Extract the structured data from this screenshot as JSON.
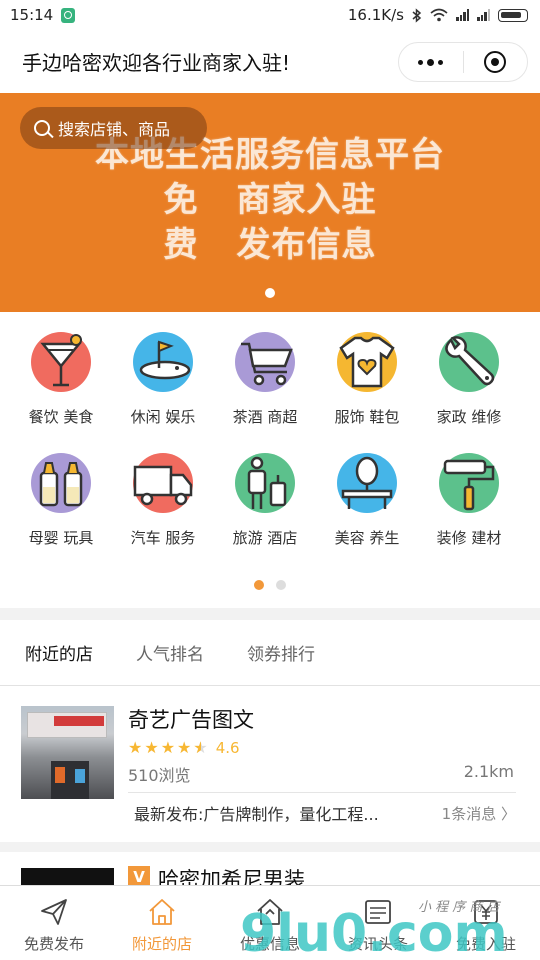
{
  "status_bar": {
    "time": "15:14",
    "network_speed": "16.1K/s"
  },
  "nav": {
    "title": "手边哈密欢迎各行业商家入驻!"
  },
  "banner": {
    "search_placeholder": "搜索店铺、商品",
    "line1": "本地生活服务信息平台",
    "line2_a": "免",
    "line2_b": "商家入驻",
    "line3_a": "费",
    "line3_b": "发布信息",
    "background_color": "#e97e24"
  },
  "categories": [
    {
      "label": "餐饮 美食",
      "icon": "cocktail-glass-icon",
      "color": "#f06b5f"
    },
    {
      "label": "休闲 娱乐",
      "icon": "golf-icon",
      "color": "#45b5e8"
    },
    {
      "label": "茶酒 商超",
      "icon": "shopping-cart-icon",
      "color": "#a99ad6"
    },
    {
      "label": "服饰 鞋包",
      "icon": "tshirt-icon",
      "color": "#f5b731"
    },
    {
      "label": "家政 维修",
      "icon": "wrench-icon",
      "color": "#5cc18c"
    },
    {
      "label": "母婴 玩具",
      "icon": "baby-bottle-icon",
      "color": "#a99ad6"
    },
    {
      "label": "汽车 服务",
      "icon": "truck-icon",
      "color": "#f06b5f"
    },
    {
      "label": "旅游 酒店",
      "icon": "traveler-luggage-icon",
      "color": "#5cc18c"
    },
    {
      "label": "美容 养生",
      "icon": "mirror-icon",
      "color": "#45b5e8"
    },
    {
      "label": "装修 建材",
      "icon": "paint-roller-icon",
      "color": "#5cc18c"
    }
  ],
  "tabs": [
    {
      "label": "附近的店",
      "active": true
    },
    {
      "label": "人气排名",
      "active": false
    },
    {
      "label": "领券排行",
      "active": false
    }
  ],
  "shop": {
    "name": "奇艺广告图文",
    "rating": 4.6,
    "rating_text": "4.6",
    "views": "510浏览",
    "distance": "2.1km",
    "latest": "最新发布:广告牌制作，量化工程...",
    "message_count": "1条消息"
  },
  "shop2": {
    "badge": "V",
    "name": "哈密加希尼男装"
  },
  "tabbar": [
    {
      "label": "免费发布",
      "icon": "paper-plane-icon",
      "active": false
    },
    {
      "label": "附近的店",
      "icon": "home-icon",
      "active": true
    },
    {
      "label": "优惠信息",
      "icon": "discount-house-icon",
      "active": false
    },
    {
      "label": "资讯头条",
      "icon": "news-icon",
      "active": false
    },
    {
      "label": "免费入驻",
      "icon": "yuan-tag-icon",
      "active": false
    }
  ],
  "watermark": {
    "text": "9lu0.com",
    "sub": "小 程 序 商 店"
  },
  "accent_color": "#f2983a"
}
